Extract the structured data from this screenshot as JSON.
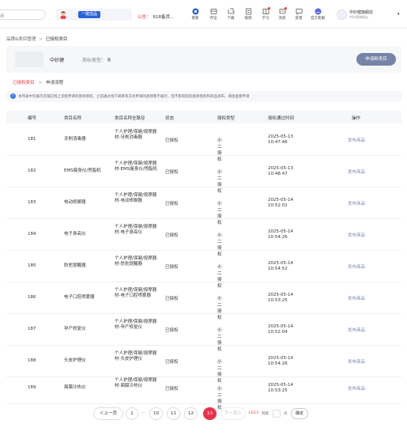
{
  "topbar": {
    "search_text": "商",
    "promo_button": "一键选品",
    "notice_label": "公告：",
    "notice_text": "618备货...",
    "nav": [
      {
        "label": "管家",
        "icon": "butler-icon",
        "dot": false
      },
      {
        "label": "存证",
        "icon": "evidence-icon",
        "dot": false
      },
      {
        "label": "下载",
        "icon": "download-icon",
        "dot": false
      },
      {
        "label": "规则",
        "icon": "rules-icon",
        "dot": false
      },
      {
        "label": "学习",
        "icon": "learn-icon",
        "dot": true
      },
      {
        "label": "消息",
        "icon": "message-icon",
        "dot": true
      },
      {
        "label": "反馈",
        "icon": "feedback-icon",
        "dot": false
      },
      {
        "label": "官方客服",
        "icon": "service-icon",
        "dot": false
      }
    ],
    "shop_name": "中妙健旗舰店",
    "shop_sub": "中妙健旗舰店"
  },
  "breadcrumb": {
    "parent": "品牌&类目管理",
    "current": "已授权类目"
  },
  "brand": {
    "name": "中妙健",
    "type_label": "商标类型：",
    "type_value": "R",
    "apply_button": "申请新类目"
  },
  "tabs": {
    "active": "已授权类目",
    "other": "申请流程"
  },
  "info_text": "本列表中仅展示店铺已线上流程申请的类目授权，之前通过线下邮寄等方式申请的类目暂不展示，但不影响您的类目授权和商品发布，请放查看申请",
  "table": {
    "headers": {
      "id": "编号",
      "name": "类目名称",
      "path": "类目名称全路径",
      "status": "状态",
      "type": "授权类型",
      "time": "授权通过时间",
      "action": "操作"
    },
    "rows": [
      {
        "id": "181",
        "name": "牙刷消毒器",
        "path": "个人护理/保健/按摩器材-牙刷消毒器",
        "status": "已授权",
        "type": "小二授权",
        "time": "2025-05-13 10:47:46",
        "action": "发布商品"
      },
      {
        "id": "182",
        "name": "EMS瘦身仪/甩脂机",
        "path": "个人护理/保健/按摩器材-EMS瘦身仪/甩脂机",
        "status": "已授权",
        "type": "小二授权",
        "time": "2025-05-13 10:48:47",
        "action": "发布商品"
      },
      {
        "id": "183",
        "name": "电动修脚器",
        "path": "个人护理/保健/按摩器材-电动修脚器",
        "status": "已授权",
        "type": "小二授权",
        "time": "2025-05-14 10:52:02",
        "action": "发布商品"
      },
      {
        "id": "184",
        "name": "电子身高仪",
        "path": "个人护理/保健/按摩器材-电子身高仪",
        "status": "已授权",
        "type": "小二授权",
        "time": "2025-05-14 10:54:26",
        "action": "发布商品"
      },
      {
        "id": "185",
        "name": "防驼提醒器",
        "path": "个人护理/保健/按摩器材-防驼提醒器",
        "status": "已授权",
        "type": "小二授权",
        "time": "2025-05-14 10:54:52",
        "action": "发布商品"
      },
      {
        "id": "186",
        "name": "电子口腔喷雾器",
        "path": "个人护理/保健/按摩器材-电子口腔喷雾器",
        "status": "已授权",
        "type": "小二授权",
        "time": "2025-05-14 10:53:25",
        "action": "发布商品"
      },
      {
        "id": "187",
        "name": "孕产修复仪",
        "path": "个人护理/保健/按摩器材-孕产修复仪",
        "status": "已授权",
        "type": "小二授权",
        "time": "2025-05-14 10:52:04",
        "action": "发布商品"
      },
      {
        "id": "188",
        "name": "头皮护理仪",
        "path": "个人护理/保健/按摩器材-头皮护理仪",
        "status": "已授权",
        "type": "小二授权",
        "time": "2025-05-14 10:54:26",
        "action": "发布商品"
      },
      {
        "id": "189",
        "name": "面膜冷热仪",
        "path": "个人护理/保健/按摩器材-面膜冷热仪",
        "status": "已授权",
        "type": "小二授权",
        "time": "2025-05-14 10:53:25",
        "action": "发布商品"
      }
    ]
  },
  "pager": {
    "prev": "＜上一页",
    "first": "1",
    "ellipsis": "···",
    "p10": "10",
    "p11": "11",
    "p12": "12",
    "current": "13",
    "next": "下一页＞",
    "page_info": "13/13",
    "goto_label": "到第",
    "page_unit": "页",
    "confirm": "确定"
  },
  "colors": {
    "accent_red": "#e8334a",
    "primary_blue": "#2a62d8",
    "link": "#7a8ab8"
  }
}
